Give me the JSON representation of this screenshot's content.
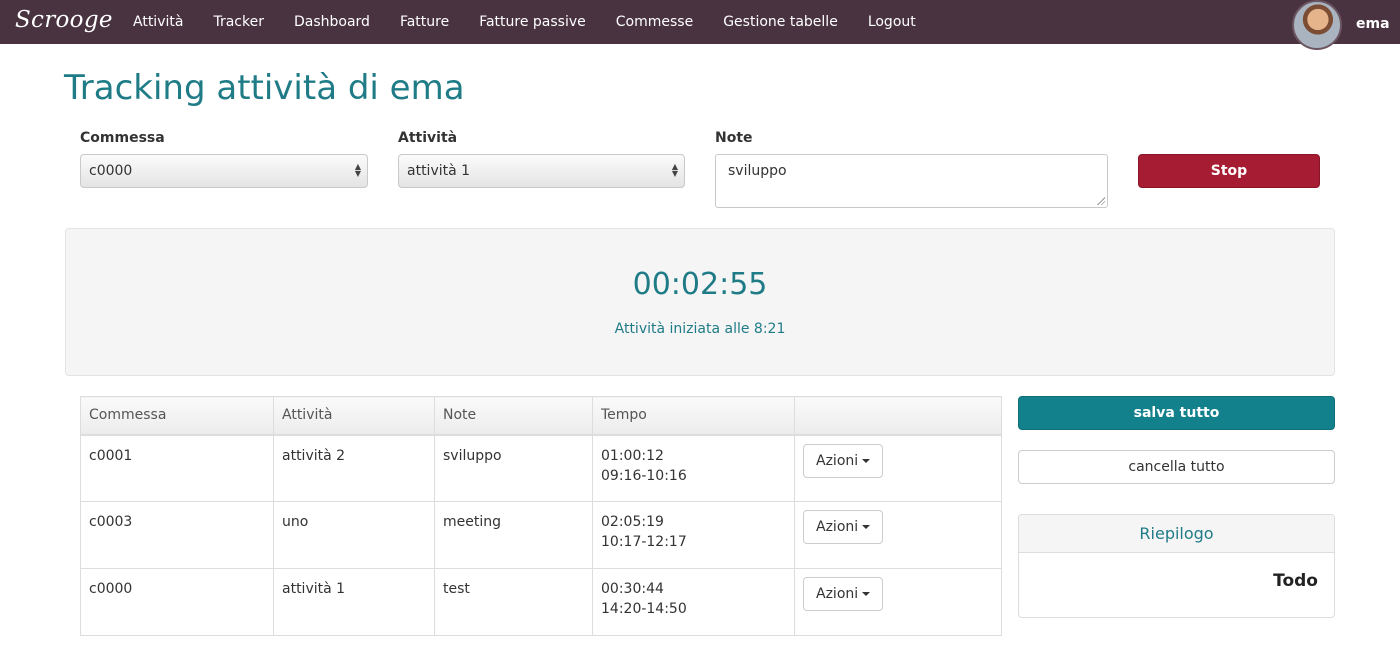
{
  "nav": {
    "brand": "Scrooge",
    "links": [
      "Attività",
      "Tracker",
      "Dashboard",
      "Fatture",
      "Fatture passive",
      "Commesse",
      "Gestione tabelle",
      "Logout"
    ],
    "user": "ema"
  },
  "page": {
    "title": "Tracking attività di ema"
  },
  "form": {
    "commessa_label": "Commessa",
    "commessa_value": "c0000",
    "attivita_label": "Attività",
    "attivita_value": "attività 1",
    "note_label": "Note",
    "note_value": "sviluppo",
    "stop_label": "Stop"
  },
  "timer": {
    "elapsed": "00:02:55",
    "started": "Attività iniziata alle 8:21"
  },
  "table": {
    "headers": [
      "Commessa",
      "Attività",
      "Note",
      "Tempo",
      ""
    ],
    "rows": [
      {
        "commessa": "c0001",
        "attivita": "attività 2",
        "note": "sviluppo",
        "durata": "01:00:12",
        "intervallo": "09:16-10:16",
        "azioni": "Azioni"
      },
      {
        "commessa": "c0003",
        "attivita": "uno",
        "note": "meeting",
        "durata": "02:05:19",
        "intervallo": "10:17-12:17",
        "azioni": "Azioni"
      },
      {
        "commessa": "c0000",
        "attivita": "attività 1",
        "note": "test",
        "durata": "00:30:44",
        "intervallo": "14:20-14:50",
        "azioni": "Azioni"
      }
    ]
  },
  "sidebar": {
    "save_all": "salva tutto",
    "clear_all": "cancella tutto",
    "summary_title": "Riepilogo",
    "summary_value": "Todo"
  },
  "colors": {
    "navbar": "#4a3340",
    "accent": "#1f7c87",
    "stop": "#a61c32",
    "save": "#13818c"
  },
  "icons": {
    "select_arrows": "updown-arrows-icon",
    "dropdown": "caret-down-icon",
    "avatar": "user-avatar"
  }
}
